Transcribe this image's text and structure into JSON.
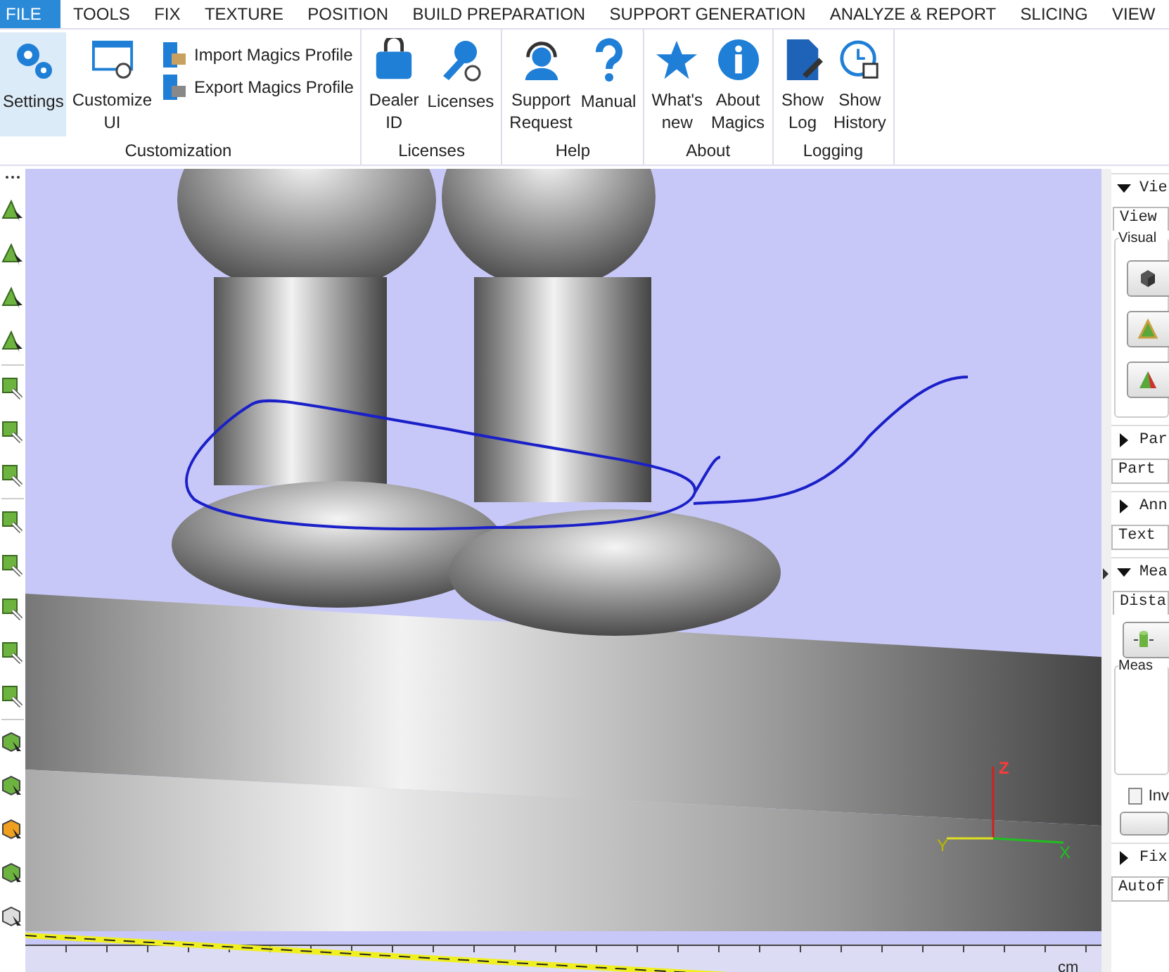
{
  "menu": [
    {
      "label": "FILE",
      "selected": true
    },
    {
      "label": "TOOLS",
      "selected": false
    },
    {
      "label": "FIX",
      "selected": false
    },
    {
      "label": "TEXTURE",
      "selected": false
    },
    {
      "label": "POSITION",
      "selected": false
    },
    {
      "label": "BUILD PREPARATION",
      "selected": false
    },
    {
      "label": "SUPPORT GENERATION",
      "selected": false
    },
    {
      "label": "ANALYZE & REPORT",
      "selected": false
    },
    {
      "label": "SLICING",
      "selected": false
    },
    {
      "label": "VIEW",
      "selected": false
    }
  ],
  "ribbon": [
    {
      "title": "Customization",
      "items": [
        {
          "kind": "large",
          "label": "Settings",
          "selected": true
        },
        {
          "kind": "large",
          "label": "Customize UI",
          "selected": false
        },
        {
          "kind": "small",
          "label": "Import Magics Profile",
          "selected": false
        },
        {
          "kind": "small",
          "label": "Export Magics Profile",
          "selected": false
        }
      ]
    },
    {
      "title": "Licenses",
      "items": [
        {
          "kind": "large",
          "label": "Dealer ID",
          "selected": false
        },
        {
          "kind": "large",
          "label": "Licenses",
          "selected": false
        }
      ]
    },
    {
      "title": "Help",
      "items": [
        {
          "kind": "large",
          "label": "Support Request",
          "selected": false
        },
        {
          "kind": "large",
          "label": "Manual",
          "selected": false
        }
      ]
    },
    {
      "title": "About",
      "items": [
        {
          "kind": "large",
          "label": "What's new",
          "selected": false
        },
        {
          "kind": "large",
          "label": "About Magics",
          "selected": false
        }
      ]
    },
    {
      "title": "Logging",
      "items": [
        {
          "kind": "large",
          "label": "Show Log",
          "selected": false
        },
        {
          "kind": "large",
          "label": "Show History",
          "selected": false
        }
      ]
    }
  ],
  "viewport": {
    "axis_labels": {
      "x": "X",
      "y": "Y",
      "z": "Z"
    },
    "ruler_unit": "cm"
  },
  "right_panel": [
    {
      "title": "Vie",
      "expanded": true,
      "items": [
        {
          "kind": "tab",
          "label": "View"
        },
        {
          "kind": "group",
          "label": "Visual",
          "buttons": [
            {
              "kind": "cube"
            },
            {
              "kind": "triangle"
            },
            {
              "kind": "triangle-cut"
            }
          ]
        }
      ]
    },
    {
      "title": "Par",
      "expanded": false,
      "items": [
        {
          "kind": "field",
          "label": "Part"
        }
      ]
    },
    {
      "title": "Ann",
      "expanded": false,
      "items": [
        {
          "kind": "field",
          "label": "Text"
        }
      ]
    },
    {
      "title": "Mea",
      "expanded": true,
      "items": [
        {
          "kind": "tab",
          "label": "Dista"
        },
        {
          "kind": "icon-button"
        },
        {
          "kind": "group",
          "label": "Meas"
        },
        {
          "kind": "checkbox",
          "label": "Inv",
          "checked": false
        },
        {
          "kind": "plain-button"
        }
      ]
    },
    {
      "title": "Fix",
      "expanded": false,
      "items": [
        {
          "kind": "field",
          "label": "Autof"
        }
      ]
    }
  ]
}
